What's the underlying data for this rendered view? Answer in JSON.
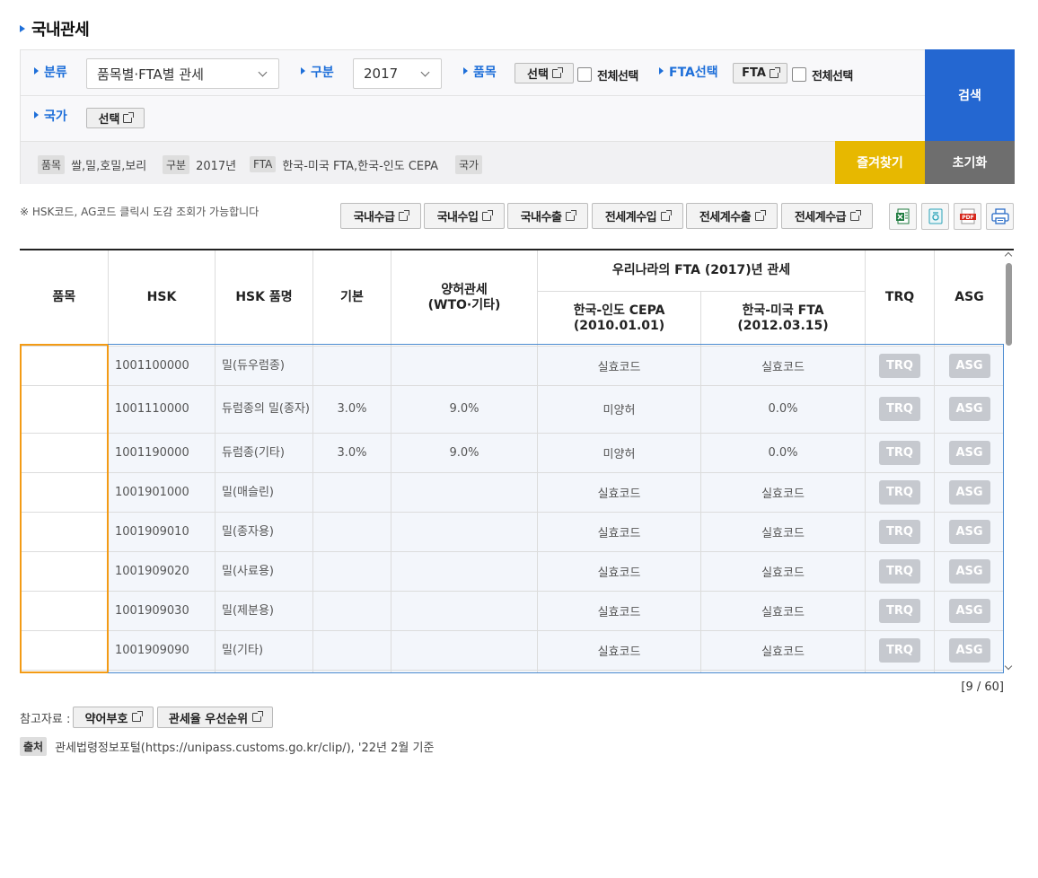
{
  "page_title": "국내관세",
  "search": {
    "classification_label": "분류",
    "classification_value": "품목별·FTA별 관세",
    "category_label": "구분",
    "category_value": "2017",
    "item_label": "품목",
    "item_select_label": "선택",
    "item_select_all_label": "전체선택",
    "fta_label": "FTA선택",
    "fta_select_label": "FTA",
    "fta_select_all_label": "전체선택",
    "country_label": "국가",
    "country_select_label": "선택",
    "search_button": "검색",
    "favorite_button": "즐겨찾기",
    "reset_button": "초기화"
  },
  "summary": {
    "item_tag": "품목",
    "item_value": "쌀,밀,호밀,보리",
    "category_tag": "구분",
    "category_value": "2017년",
    "fta_tag": "FTA",
    "fta_value": "한국-미국 FTA,한국-인도 CEPA",
    "country_tag": "국가",
    "country_value": ""
  },
  "notice": "※ HSK코드, AG코드 클릭시 도감 조회가 가능합니다",
  "report_buttons": [
    "국내수급",
    "국내수입",
    "국내수출",
    "전세계수입",
    "전세계수출",
    "전세계수급"
  ],
  "export_icons": [
    "excel-icon",
    "hwp-icon",
    "pdf-icon",
    "print-icon"
  ],
  "table": {
    "headers": {
      "item": "품목",
      "hsk": "HSK",
      "hsk_name": "HSK 품명",
      "basic": "기본",
      "concession_line1": "양허관세",
      "concession_line2": "(WTO·기타)",
      "fta_group": "우리나라의 FTA (2017)년 관세",
      "fta1_line1": "한국-인도 CEPA",
      "fta1_line2": "(2010.01.01)",
      "fta2_line1": "한국-미국 FTA",
      "fta2_line2": "(2012.03.15)",
      "trq": "TRQ",
      "asg": "ASG"
    },
    "rows": [
      {
        "item": "",
        "hsk": "1001100000",
        "name": "밀(듀우럼종)",
        "basic": "",
        "concession": "",
        "fta1": "실효코드",
        "fta2": "실효코드",
        "trq": "TRQ",
        "asg": "ASG"
      },
      {
        "item": "",
        "hsk": "1001110000",
        "name": "듀럼종의 밀(종자)",
        "basic": "3.0%",
        "concession": "9.0%",
        "fta1": "미양허",
        "fta2": "0.0%",
        "trq": "TRQ",
        "asg": "ASG"
      },
      {
        "item": "",
        "hsk": "1001190000",
        "name": "듀럼종(기타)",
        "basic": "3.0%",
        "concession": "9.0%",
        "fta1": "미양허",
        "fta2": "0.0%",
        "trq": "TRQ",
        "asg": "ASG"
      },
      {
        "item": "",
        "hsk": "1001901000",
        "name": "밀(매슬린)",
        "basic": "",
        "concession": "",
        "fta1": "실효코드",
        "fta2": "실효코드",
        "trq": "TRQ",
        "asg": "ASG"
      },
      {
        "item": "",
        "hsk": "1001909010",
        "name": "밀(종자용)",
        "basic": "",
        "concession": "",
        "fta1": "실효코드",
        "fta2": "실효코드",
        "trq": "TRQ",
        "asg": "ASG"
      },
      {
        "item": "",
        "hsk": "1001909020",
        "name": "밀(사료용)",
        "basic": "",
        "concession": "",
        "fta1": "실효코드",
        "fta2": "실효코드",
        "trq": "TRQ",
        "asg": "ASG"
      },
      {
        "item": "",
        "hsk": "1001909030",
        "name": "밀(제분용)",
        "basic": "",
        "concession": "",
        "fta1": "실효코드",
        "fta2": "실효코드",
        "trq": "TRQ",
        "asg": "ASG"
      },
      {
        "item": "",
        "hsk": "1001909090",
        "name": "밀(기타)",
        "basic": "",
        "concession": "",
        "fta1": "실효코드",
        "fta2": "실효코드",
        "trq": "TRQ",
        "asg": "ASG"
      }
    ]
  },
  "pager": "[9 / 60]",
  "reference": {
    "label": "참고자료 :",
    "buttons": [
      "약어부호",
      "관세율 우선순위"
    ]
  },
  "source": {
    "tag": "출처",
    "text": "관세법령정보포털(https://unipass.customs.go.kr/clip/), '22년 2월 기준"
  }
}
